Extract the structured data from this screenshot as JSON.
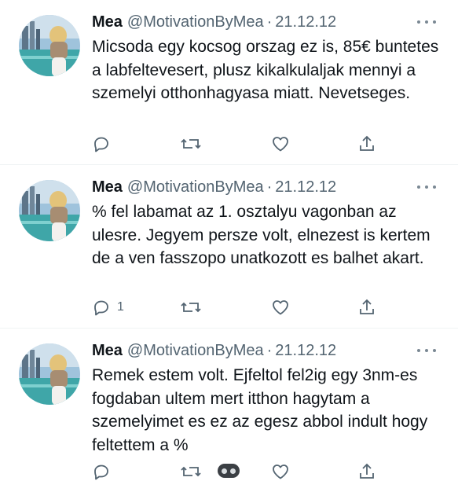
{
  "colors": {
    "text_primary": "#0f1419",
    "text_secondary": "#536471",
    "divider": "#eff3f4"
  },
  "tweets": [
    {
      "name": "Mea",
      "handle": "@MotivationByMea",
      "separator": "·",
      "date": "21.12.12",
      "text": "Micsoda egy kocsog orszag ez is, 85€ buntetes a labfeltevesert, plusz kikalkulaljak mennyi a szemelyi otthonhagyasa miatt. Nevetseges.",
      "reply_count": "",
      "icons": [
        "reply-icon",
        "retweet-icon",
        "like-icon",
        "share-icon",
        "more-icon"
      ]
    },
    {
      "name": "Mea",
      "handle": "@MotivationByMea",
      "separator": "·",
      "date": "21.12.12",
      "text": "% fel labamat az 1. osztalyu vagonban az ulesre. Jegyem persze volt, elnezest is kertem de a ven fasszopo unatkozott es balhet akart.",
      "reply_count": "1",
      "icons": [
        "reply-icon",
        "retweet-icon",
        "like-icon",
        "share-icon",
        "more-icon"
      ]
    },
    {
      "name": "Mea",
      "handle": "@MotivationByMea",
      "separator": "·",
      "date": "21.12.12",
      "text": "Remek estem volt. Ejfeltol fel2ig egy 3nm-es fogdaban ultem mert itthon hagytam a szemelyimet es ez az egesz abbol indult hogy feltettem a %",
      "reply_count": "",
      "icons": [
        "reply-icon",
        "retweet-icon",
        "like-icon",
        "share-icon",
        "more-icon",
        "toggle-pill-icon"
      ]
    }
  ]
}
